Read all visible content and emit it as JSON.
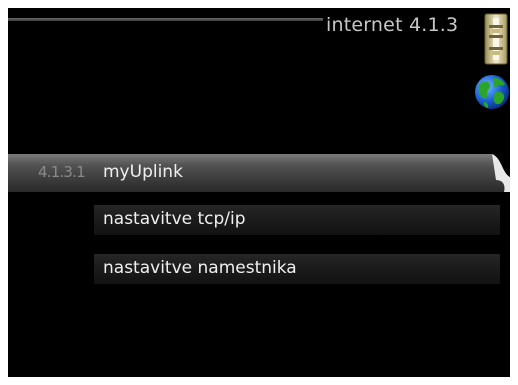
{
  "screen": {
    "title": "internet 4.1.3"
  },
  "icons": {
    "thermostat": "thermostat-icon",
    "globe": "globe-icon"
  },
  "menu": {
    "items": [
      {
        "number": "4.1.3.1",
        "label": "myUplink",
        "selected": true
      },
      {
        "number": "",
        "label": "nastavitve tcp/ip",
        "selected": false
      },
      {
        "number": "",
        "label": "nastavitve namestnika",
        "selected": false
      }
    ]
  },
  "colors": {
    "background": "#000000",
    "text": "#f0f0f0",
    "title": "#c7c7c7",
    "selected_bar": "#525252"
  }
}
